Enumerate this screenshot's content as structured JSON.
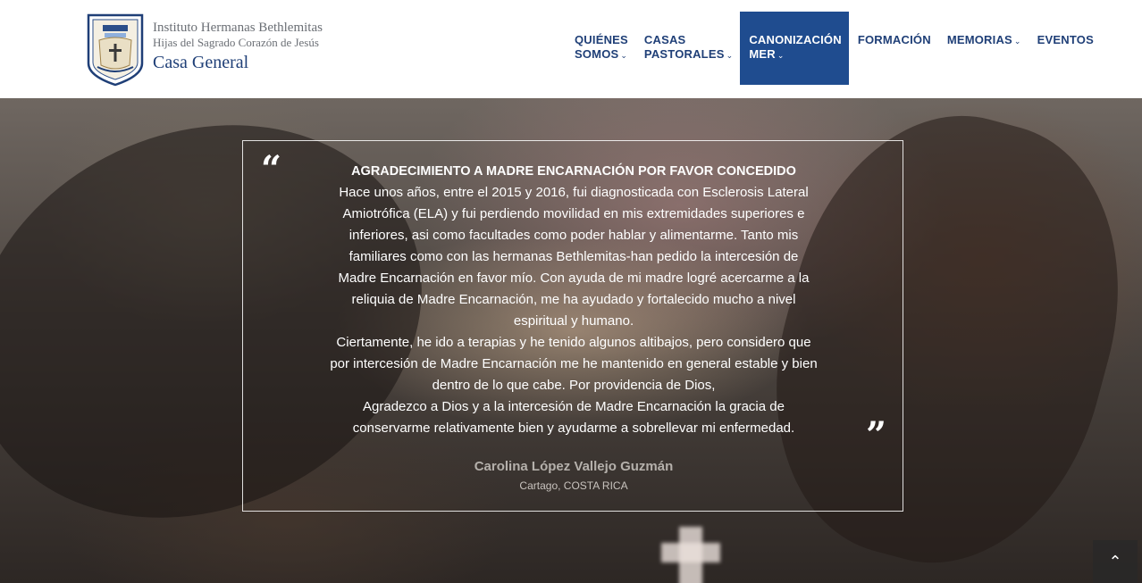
{
  "logo": {
    "line1": "Instituto Hermanas Bethlemitas",
    "line2": "Hijas del Sagrado Corazón de Jesús",
    "line3": "Casa General"
  },
  "nav": {
    "items": [
      {
        "line1": "QUIÉNES",
        "line2": "SOMOS",
        "dropdown": true
      },
      {
        "line1": "CASAS",
        "line2": "PASTORALES",
        "dropdown": true
      },
      {
        "line1": "CANONIZACIÓN",
        "line2": "MER",
        "dropdown": true,
        "active": true
      },
      {
        "line1": "FORMACIÓN",
        "line2": "",
        "dropdown": false
      },
      {
        "line1": "MEMORIAS",
        "line2": "",
        "dropdown": true
      },
      {
        "line1": "EVENTOS",
        "line2": "",
        "dropdown": false
      }
    ],
    "chevron": "⌄"
  },
  "testimonial": {
    "open_quote": "“",
    "close_quote": "”",
    "title": "AGRADECIMIENTO A MADRE ENCARNACIÓN POR FAVOR CONCEDIDO",
    "lines": [
      "Hace unos años, entre el 2015 y 2016, fui diagnosticada con Esclerosis Lateral",
      "Amiotrófica (ELA) y fui perdiendo movilidad en mis extremidades superiores e",
      "inferiores, asi como facultades como poder hablar y alimentarme. Tanto mis",
      "familiares como  con las hermanas Bethlemitas-han pedido la intercesión de",
      "Madre Encarnación en favor mío.  Con ayuda de mi madre logré acercarme a la",
      "reliquia de Madre Encarnación, me ha  ayudado y fortalecido mucho a nivel",
      "espiritual y humano.",
      "Ciertamente, he ido a terapias y he tenido algunos altibajos, pero considero que",
      "por intercesión de Madre Encarnación me he mantenido en general estable y bien",
      "dentro de lo que cabe. Por providencia de Dios,",
      "Agradezco a Dios y a la intercesión de Madre Encarnación la gracia de",
      "conservarme relativamente bien y ayudarme a sobrellevar mi enfermedad."
    ],
    "author": "Carolina López Vallejo Guzmán",
    "location": "Cartago, COSTA RICA"
  },
  "scroll_top": {
    "icon": "chevron-up-icon",
    "glyph": "⌃"
  },
  "colors": {
    "brand": "#1f3f77",
    "active_nav": "#1f4c8f"
  }
}
